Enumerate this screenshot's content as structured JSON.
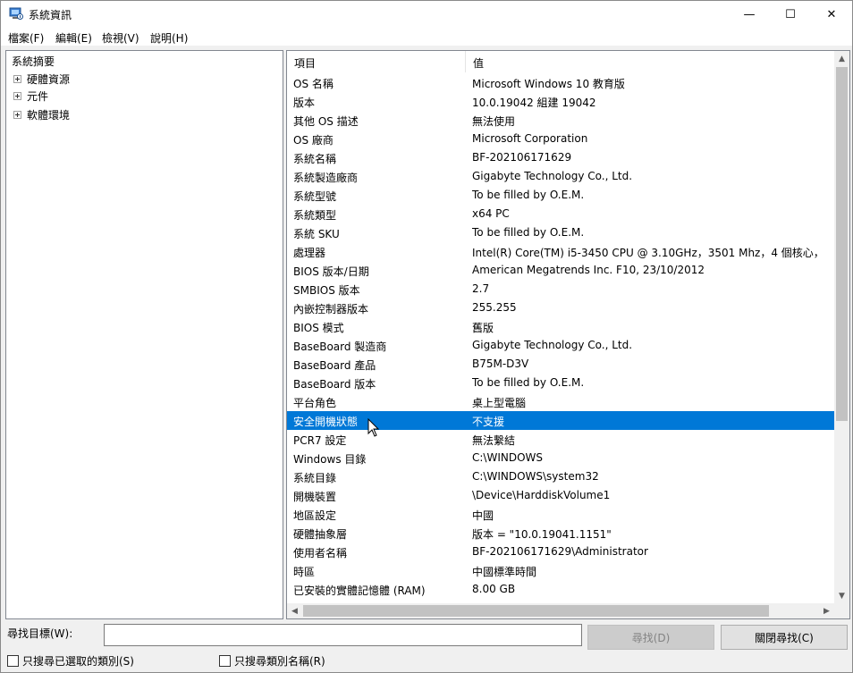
{
  "window": {
    "title": "系統資訊",
    "minimize_glyph": "—",
    "maximize_glyph": "☐",
    "close_glyph": "✕"
  },
  "menu": [
    "檔案(F)",
    "編輯(E)",
    "檢視(V)",
    "說明(H)"
  ],
  "tree": {
    "root": "系統摘要",
    "children": [
      "硬體資源",
      "元件",
      "軟體環境"
    ]
  },
  "table": {
    "headers": {
      "item": "項目",
      "value": "值"
    },
    "selected_index": 18,
    "rows": [
      {
        "item": "OS 名稱",
        "value": "Microsoft Windows 10 教育版"
      },
      {
        "item": "版本",
        "value": "10.0.19042 組建 19042"
      },
      {
        "item": "其他 OS 描述",
        "value": "無法使用"
      },
      {
        "item": "OS 廠商",
        "value": "Microsoft Corporation"
      },
      {
        "item": "系統名稱",
        "value": "BF-202106171629"
      },
      {
        "item": "系統製造廠商",
        "value": "Gigabyte Technology Co., Ltd."
      },
      {
        "item": "系統型號",
        "value": "To be filled by O.E.M."
      },
      {
        "item": "系統類型",
        "value": "x64 PC"
      },
      {
        "item": "系統 SKU",
        "value": "To be filled by O.E.M."
      },
      {
        "item": "處理器",
        "value": "Intel(R) Core(TM) i5-3450 CPU @ 3.10GHz，3501 Mhz，4 個核心，"
      },
      {
        "item": "BIOS 版本/日期",
        "value": "American Megatrends Inc. F10, 23/10/2012"
      },
      {
        "item": "SMBIOS 版本",
        "value": "2.7"
      },
      {
        "item": "內嵌控制器版本",
        "value": "255.255"
      },
      {
        "item": "BIOS 模式",
        "value": "舊版"
      },
      {
        "item": "BaseBoard 製造商",
        "value": "Gigabyte Technology Co., Ltd."
      },
      {
        "item": "BaseBoard 產品",
        "value": "B75M-D3V"
      },
      {
        "item": "BaseBoard 版本",
        "value": "To be filled by O.E.M."
      },
      {
        "item": "平台角色",
        "value": "桌上型電腦"
      },
      {
        "item": "安全開機狀態",
        "value": "不支援"
      },
      {
        "item": "PCR7 設定",
        "value": "無法繫結"
      },
      {
        "item": "Windows 目錄",
        "value": "C:\\WINDOWS"
      },
      {
        "item": "系統目錄",
        "value": "C:\\WINDOWS\\system32"
      },
      {
        "item": "開機裝置",
        "value": "\\Device\\HarddiskVolume1"
      },
      {
        "item": "地區設定",
        "value": "中國"
      },
      {
        "item": "硬體抽象層",
        "value": "版本 = \"10.0.19041.1151\""
      },
      {
        "item": "使用者名稱",
        "value": "BF-202106171629\\Administrator"
      },
      {
        "item": "時區",
        "value": "中國標準時間"
      },
      {
        "item": "已安裝的實體記憶體 (RAM)",
        "value": "8.00 GB"
      }
    ]
  },
  "scroll": {
    "up": "▲",
    "down": "▼",
    "left": "◀",
    "right": "▶"
  },
  "find": {
    "label": "尋找目標(W):",
    "value": "",
    "find_button": "尋找(D)",
    "close_button": "關閉尋找(C)",
    "search_selected_only": "只搜尋已選取的類別(S)",
    "search_category_names": "只搜尋類別名稱(R)",
    "search_selected_only_checked": false,
    "search_category_names_checked": false
  },
  "colors": {
    "selection": "#0078d7",
    "window_bg": "#f0f0f0"
  }
}
